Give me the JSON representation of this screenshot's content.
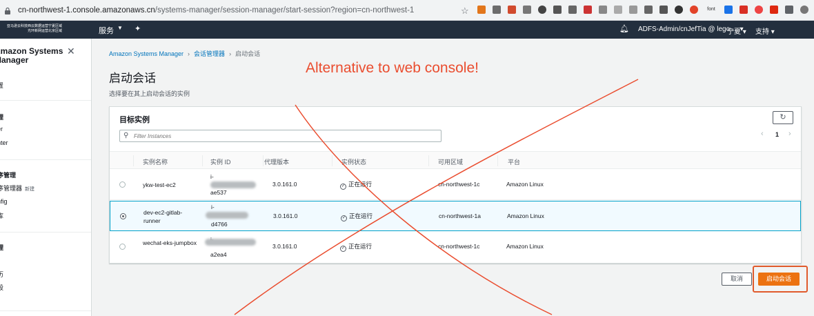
{
  "browser": {
    "url_host": "cn-northwest-1.console.amazonaws.cn",
    "url_path": "/systems-manager/session-manager/start-session?region=cn-northwest-1",
    "extension_font_label": "font"
  },
  "topnav": {
    "logo_line1": "亚马逊云科技",
    "logo_line2": "西云数据运营宁夏区域",
    "logo_line3": "光环新网运营北京区域",
    "services_label": "服务",
    "user_label": "ADFS-Admin/cnJefTia @ lego-...",
    "region_label": "宁夏",
    "support_label": "支持"
  },
  "sidebar": {
    "title": "Amazon Systems Manager",
    "items": [
      {
        "label": "置",
        "head": false
      },
      {
        "label": "理",
        "head": true
      },
      {
        "label": "er",
        "head": false
      },
      {
        "label": "nter",
        "head": false
      },
      {
        "label": "序管理",
        "head": true
      },
      {
        "label": "序管理器",
        "head": false,
        "badge": "新建"
      },
      {
        "label": "nfig",
        "head": false
      },
      {
        "label": "库",
        "head": false
      },
      {
        "label": "理",
        "head": true
      },
      {
        "label": "历",
        "head": false
      },
      {
        "label": "段",
        "head": false
      }
    ]
  },
  "breadcrumb": {
    "items": [
      "Amazon Systems Manager",
      "会话管理器"
    ],
    "current": "启动会话"
  },
  "page": {
    "title": "启动会话",
    "description": "选择要在其上启动会话的实例"
  },
  "panel": {
    "title": "目标实例",
    "filter_placeholder": "Filter Instances",
    "page_number": "1",
    "columns": [
      "实例名称",
      "实例 ID",
      "代理版本",
      "实例状态",
      "可用区域",
      "平台"
    ],
    "rows": [
      {
        "name": "ykw-test-ec2",
        "id_prefix": "i-",
        "id_suffix": "ae537",
        "agent_version": "3.0.161.0",
        "state": "正在运行",
        "az": "cn-northwest-1c",
        "platform": "Amazon Linux",
        "selected": false
      },
      {
        "name": "dev-ec2-gitlab-runner",
        "id_prefix": "i-",
        "id_suffix": "d4766",
        "agent_version": "3.0.161.0",
        "state": "正在运行",
        "az": "cn-northwest-1a",
        "platform": "Amazon Linux",
        "selected": true
      },
      {
        "name": "wechat-eks-jumpbox",
        "id_prefix": "i-",
        "id_suffix": "a2ea4",
        "agent_version": "3.0.161.0",
        "state": "正在运行",
        "az": "cn-northwest-1c",
        "platform": "Amazon Linux",
        "selected": false
      }
    ]
  },
  "actions": {
    "cancel_label": "取消",
    "start_label": "启动会话"
  },
  "annotation": {
    "text": "Alternative to web console!",
    "color": "#ea4d2f"
  },
  "colors": {
    "accent_orange": "#ec7211",
    "nav_bg": "#232f3e",
    "link_blue": "#0073bb"
  }
}
